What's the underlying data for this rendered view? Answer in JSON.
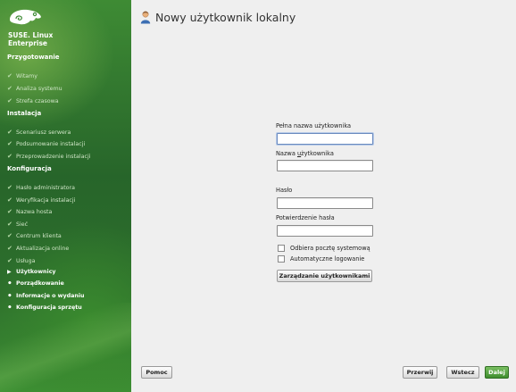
{
  "sidebar": {
    "brand_line1": "SUSE. Linux",
    "brand_line2": "Enterprise",
    "sections": [
      {
        "title": "Przygotowanie"
      },
      {
        "title": "Instalacja"
      },
      {
        "title": "Konfiguracja"
      }
    ],
    "steps": [
      {
        "label": "Witamy",
        "state": "done"
      },
      {
        "label": "Analiza systemu",
        "state": "done"
      },
      {
        "label": "Strefa czasowa",
        "state": "done"
      },
      {
        "label": "Scenariusz serwera",
        "state": "done"
      },
      {
        "label": "Podsumowanie instalacji",
        "state": "done"
      },
      {
        "label": "Przeprowadzenie instalacji",
        "state": "done"
      },
      {
        "label": "Hasło administratora",
        "state": "done"
      },
      {
        "label": "Weryfikacja instalacji",
        "state": "done"
      },
      {
        "label": "Nazwa hosta",
        "state": "done"
      },
      {
        "label": "Sieć",
        "state": "done"
      },
      {
        "label": "Centrum klienta",
        "state": "done"
      },
      {
        "label": "Aktualizacja online",
        "state": "done"
      },
      {
        "label": "Usługa",
        "state": "done"
      },
      {
        "label": "Użytkownicy",
        "state": "current"
      },
      {
        "label": "Porządkowanie",
        "state": "pending"
      },
      {
        "label": "Informacje o wydaniu",
        "state": "pending"
      },
      {
        "label": "Konfiguracja sprzętu",
        "state": "pending"
      }
    ]
  },
  "main": {
    "title": "Nowy użytkownik lokalny",
    "form": {
      "full_name_label": "Pełna nazwa użytkownika",
      "full_name_value": "",
      "username_label_pre": "Nazwa ",
      "username_label_u": "u",
      "username_label_post": "żytkownika",
      "username_value": "",
      "password_label": "Hasło",
      "password_value": "",
      "confirm_label": "Potwierdzenie hasła",
      "confirm_value": "",
      "receive_mail_label": "Odbiera pocztę systemową",
      "receive_mail_checked": false,
      "autologin_label": "Automatyczne logowanie",
      "autologin_checked": false,
      "manage_users_label": "Zarządzanie użytkownikami"
    }
  },
  "footer": {
    "help_label": "Pomoc",
    "abort_label": "Przerwij",
    "back_label": "Wstecz",
    "next_label": "Dalej"
  },
  "colors": {
    "sidebar_green": "#2d6f2c",
    "accent_green": "#3f8d2e",
    "focus_blue": "#6b8bbf"
  }
}
